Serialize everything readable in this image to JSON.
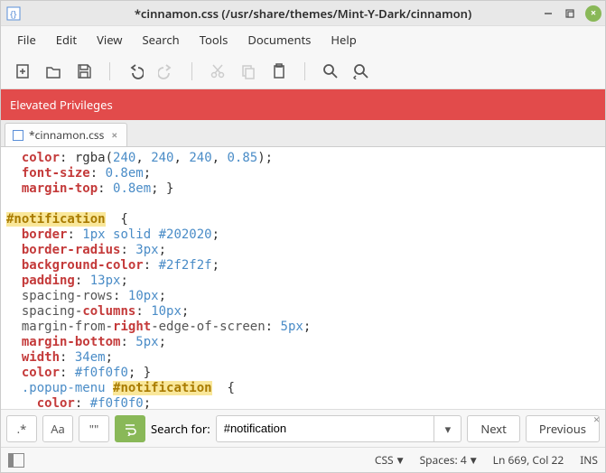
{
  "titlebar": {
    "title": "*cinnamon.css (/usr/share/themes/Mint-Y-Dark/cinnamon)"
  },
  "menubar": {
    "items": [
      "File",
      "Edit",
      "View",
      "Search",
      "Tools",
      "Documents",
      "Help"
    ]
  },
  "banner": {
    "text": "Elevated Privileges"
  },
  "tab": {
    "label": "*cinnamon.css"
  },
  "code": {
    "l1": {
      "prop": "color",
      "func": "rgba",
      "a": "240",
      "b": "240",
      "c": "240",
      "d": "0.85"
    },
    "l2": {
      "prop": "font-size",
      "val": "0.8em"
    },
    "l3": {
      "prop": "margin-top",
      "val": "0.8em"
    },
    "l5": {
      "sel": "#notification"
    },
    "l6": {
      "prop": "border",
      "val": "1px solid #202020"
    },
    "l7": {
      "prop": "border-radius",
      "val": "3px"
    },
    "l8": {
      "prop": "background-color",
      "val": "#2f2f2f"
    },
    "l9": {
      "prop": "padding",
      "val": "13px"
    },
    "l10": {
      "prop1": "spacing",
      "prop2": "rows",
      "val": "10px"
    },
    "l11": {
      "prop1": "spacing",
      "prop2": "columns",
      "val": "10px"
    },
    "l12": {
      "p1": "margin",
      "p2": "from",
      "p3": "right",
      "p4": "edge",
      "p5": "of",
      "p6": "screen",
      "val": "5px"
    },
    "l13": {
      "prop": "margin-bottom",
      "val": "5px"
    },
    "l14": {
      "prop": "width",
      "val": "34em"
    },
    "l15": {
      "prop": "color",
      "val": "#f0f0f0"
    },
    "l16": {
      "cls": ".popup-menu",
      "sel": "#notification"
    },
    "l17": {
      "prop": "color",
      "val": "#f0f0f0"
    }
  },
  "search": {
    "label": "Search for:",
    "value": "#notification",
    "next": "Next",
    "prev": "Previous",
    "regex": ".*",
    "case": "Aa",
    "word": "\"\""
  },
  "status": {
    "lang": "CSS",
    "spaces": "Spaces: 4",
    "pos": "Ln 669, Col 22",
    "ins": "INS"
  }
}
